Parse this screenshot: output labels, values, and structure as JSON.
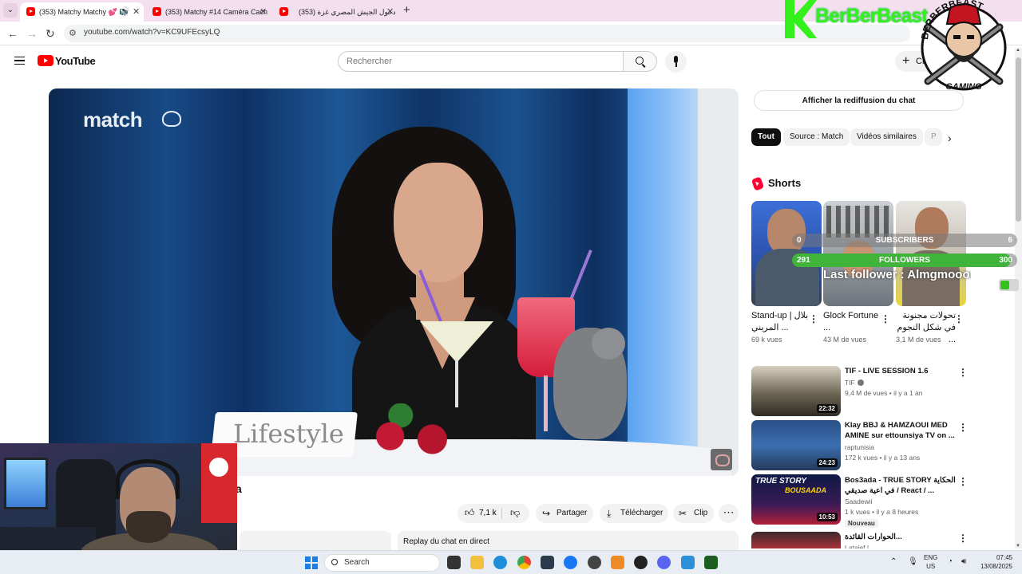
{
  "browser": {
    "tabs": [
      {
        "title": "(353) Matchy Matchy 💕 Ep",
        "active": true,
        "audio": true
      },
      {
        "title": "(353) Matchy #14 Caméra Cach",
        "active": false
      },
      {
        "title": "(353) دخول الجيش المصري غزة",
        "active": false
      }
    ],
    "new_tab": "+",
    "url": "youtube.com/watch?v=KC9UFEcsyLQ"
  },
  "youtube": {
    "logo": "YouTube",
    "search_placeholder": "Rechercher",
    "create_label": "Créer",
    "colors": {
      "brand": "#ff0000",
      "chip_active": "#0f0f0f"
    }
  },
  "video": {
    "overlay_logo": "match",
    "sign_text": "Lifestyle",
    "title_fragment": "a",
    "likes": "7,1 k",
    "share_label": "Partager",
    "download_label": "Télécharger",
    "clip_label": "Clip",
    "chat_replay": "Replay du chat en direct"
  },
  "sidebar": {
    "show_chat_replay": "Afficher la rediffusion du chat",
    "chips": [
      "Tout",
      "Source : Match",
      "Vidéos similaires",
      "P"
    ],
    "shorts_heading": "Shorts",
    "shorts": [
      {
        "title": "Stand-up بلال | المريني ...",
        "views": "69 k vues"
      },
      {
        "title": "Glock Fortune ...",
        "views": "43 M de vues"
      },
      {
        "title": "تحولات مجنونة في شكل النجوم ...",
        "views": "3,1 M de vues"
      }
    ],
    "recommendations": [
      {
        "title": "TIF - LIVE SESSION 1.6",
        "channel": "TIF",
        "meta": "9,4 M de vues • il y a 1 an",
        "duration": "22:32",
        "verified": true
      },
      {
        "title": "Klay BBJ & HAMZAOUI MED AMINE sur ettounsiya TV on ...",
        "channel": "raptunisia",
        "meta": "172 k vues • il y a 13 ans",
        "duration": "24:23"
      },
      {
        "title": "Bos3ada - TRUE STORY الحكاية في اعية صديقي / React / ...",
        "channel": "Saadewii",
        "meta": "1 k vues • il y a 8 heures",
        "duration": "10:53",
        "badge": "Nouveau",
        "thumb_text1": "TRUE STORY",
        "thumb_text2": "BOUSAADA"
      },
      {
        "title": "...الحوارات القائدة",
        "channel": "Lataief | ...",
        "meta": ""
      }
    ]
  },
  "overlay": {
    "brand_name": "BerBerBeast",
    "logo_text_top": "BERBERBEAST",
    "logo_text_bottom": "GAMING",
    "subscribers": {
      "label": "SUBSCRIBERS",
      "current": "0",
      "goal": "6",
      "progress": 0
    },
    "followers": {
      "label": "FOLLOWERS",
      "current": "291",
      "goal": "300",
      "progress": 0.97
    },
    "last_follower": "Last follower : Almgmooou",
    "accent": "#34f01d"
  },
  "taskbar": {
    "search_label": "Search",
    "lang_top": "ENG",
    "lang_bottom": "US",
    "time": "07:45",
    "date": "13/08/2025"
  }
}
